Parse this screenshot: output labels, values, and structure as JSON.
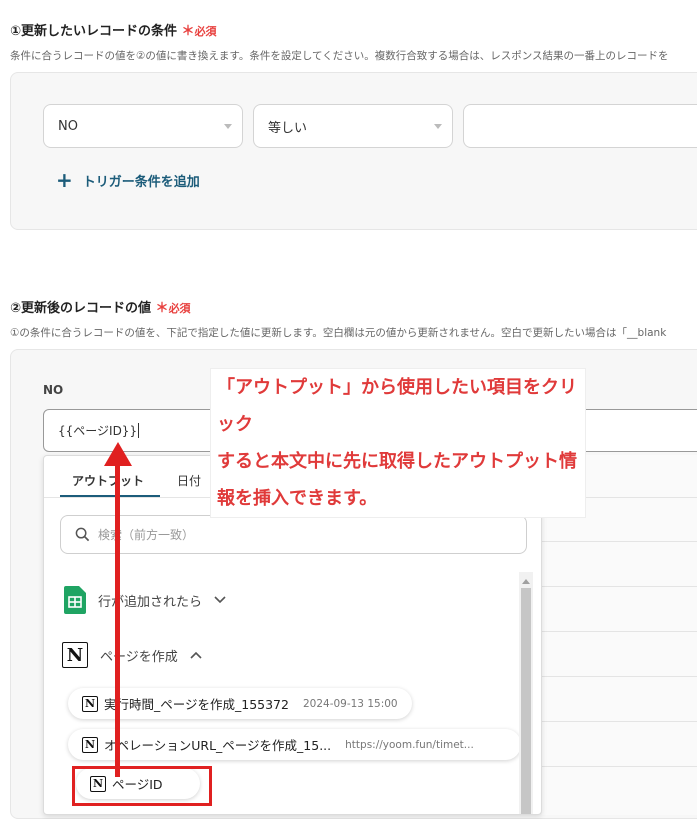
{
  "section1": {
    "title": "①更新したいレコードの条件",
    "required_star": "＊",
    "required_label": "必須",
    "description": "条件に合うレコードの値を②の値に書き換えます。条件を設定してください。複数行合致する場合は、レスポンス結果の一番上のレコードを",
    "field_select": "NO",
    "operator_select": "等しい",
    "value_input": "",
    "add_condition_label": "トリガー条件を追加"
  },
  "section2": {
    "title": "②更新後のレコードの値",
    "required_star": "＊",
    "required_label": "必須",
    "description": "①の条件に合うレコードの値を、下記で指定した値に更新します。空白欄は元の値から更新されません。空白で更新したい場合は「__blank",
    "field_label": "NO",
    "field_value": "{{ページID}}"
  },
  "dropdown": {
    "tabs": [
      "アウトプット",
      "日付"
    ],
    "active_tab": 0,
    "search_placeholder": "検索（前方一致）",
    "groups": [
      {
        "label": "行が追加されたら",
        "icon": "google-sheets-icon",
        "expanded": false
      },
      {
        "label": "ページを作成",
        "icon": "notion-icon",
        "expanded": true
      }
    ],
    "items": [
      {
        "label": "実行時間_ページを作成_155372",
        "value": "2024-09-13 15:00"
      },
      {
        "label": "オペレーションURL_ページを作成_15...",
        "value": "https://yoom.fun/timet..."
      },
      {
        "label": "ページID",
        "value": ""
      }
    ],
    "close_symbol": "×"
  },
  "annotation": {
    "lines": [
      "「アウトプット」から使用したい項目をクリック",
      "すると本文中に先に取得したアウトプット情",
      "報を挿入できます。"
    ],
    "color": "#e03a3a"
  },
  "colors": {
    "accent": "#1c5c7a",
    "required": "#e8403e",
    "highlight": "#e02020",
    "sheets_green": "#1fa463"
  }
}
